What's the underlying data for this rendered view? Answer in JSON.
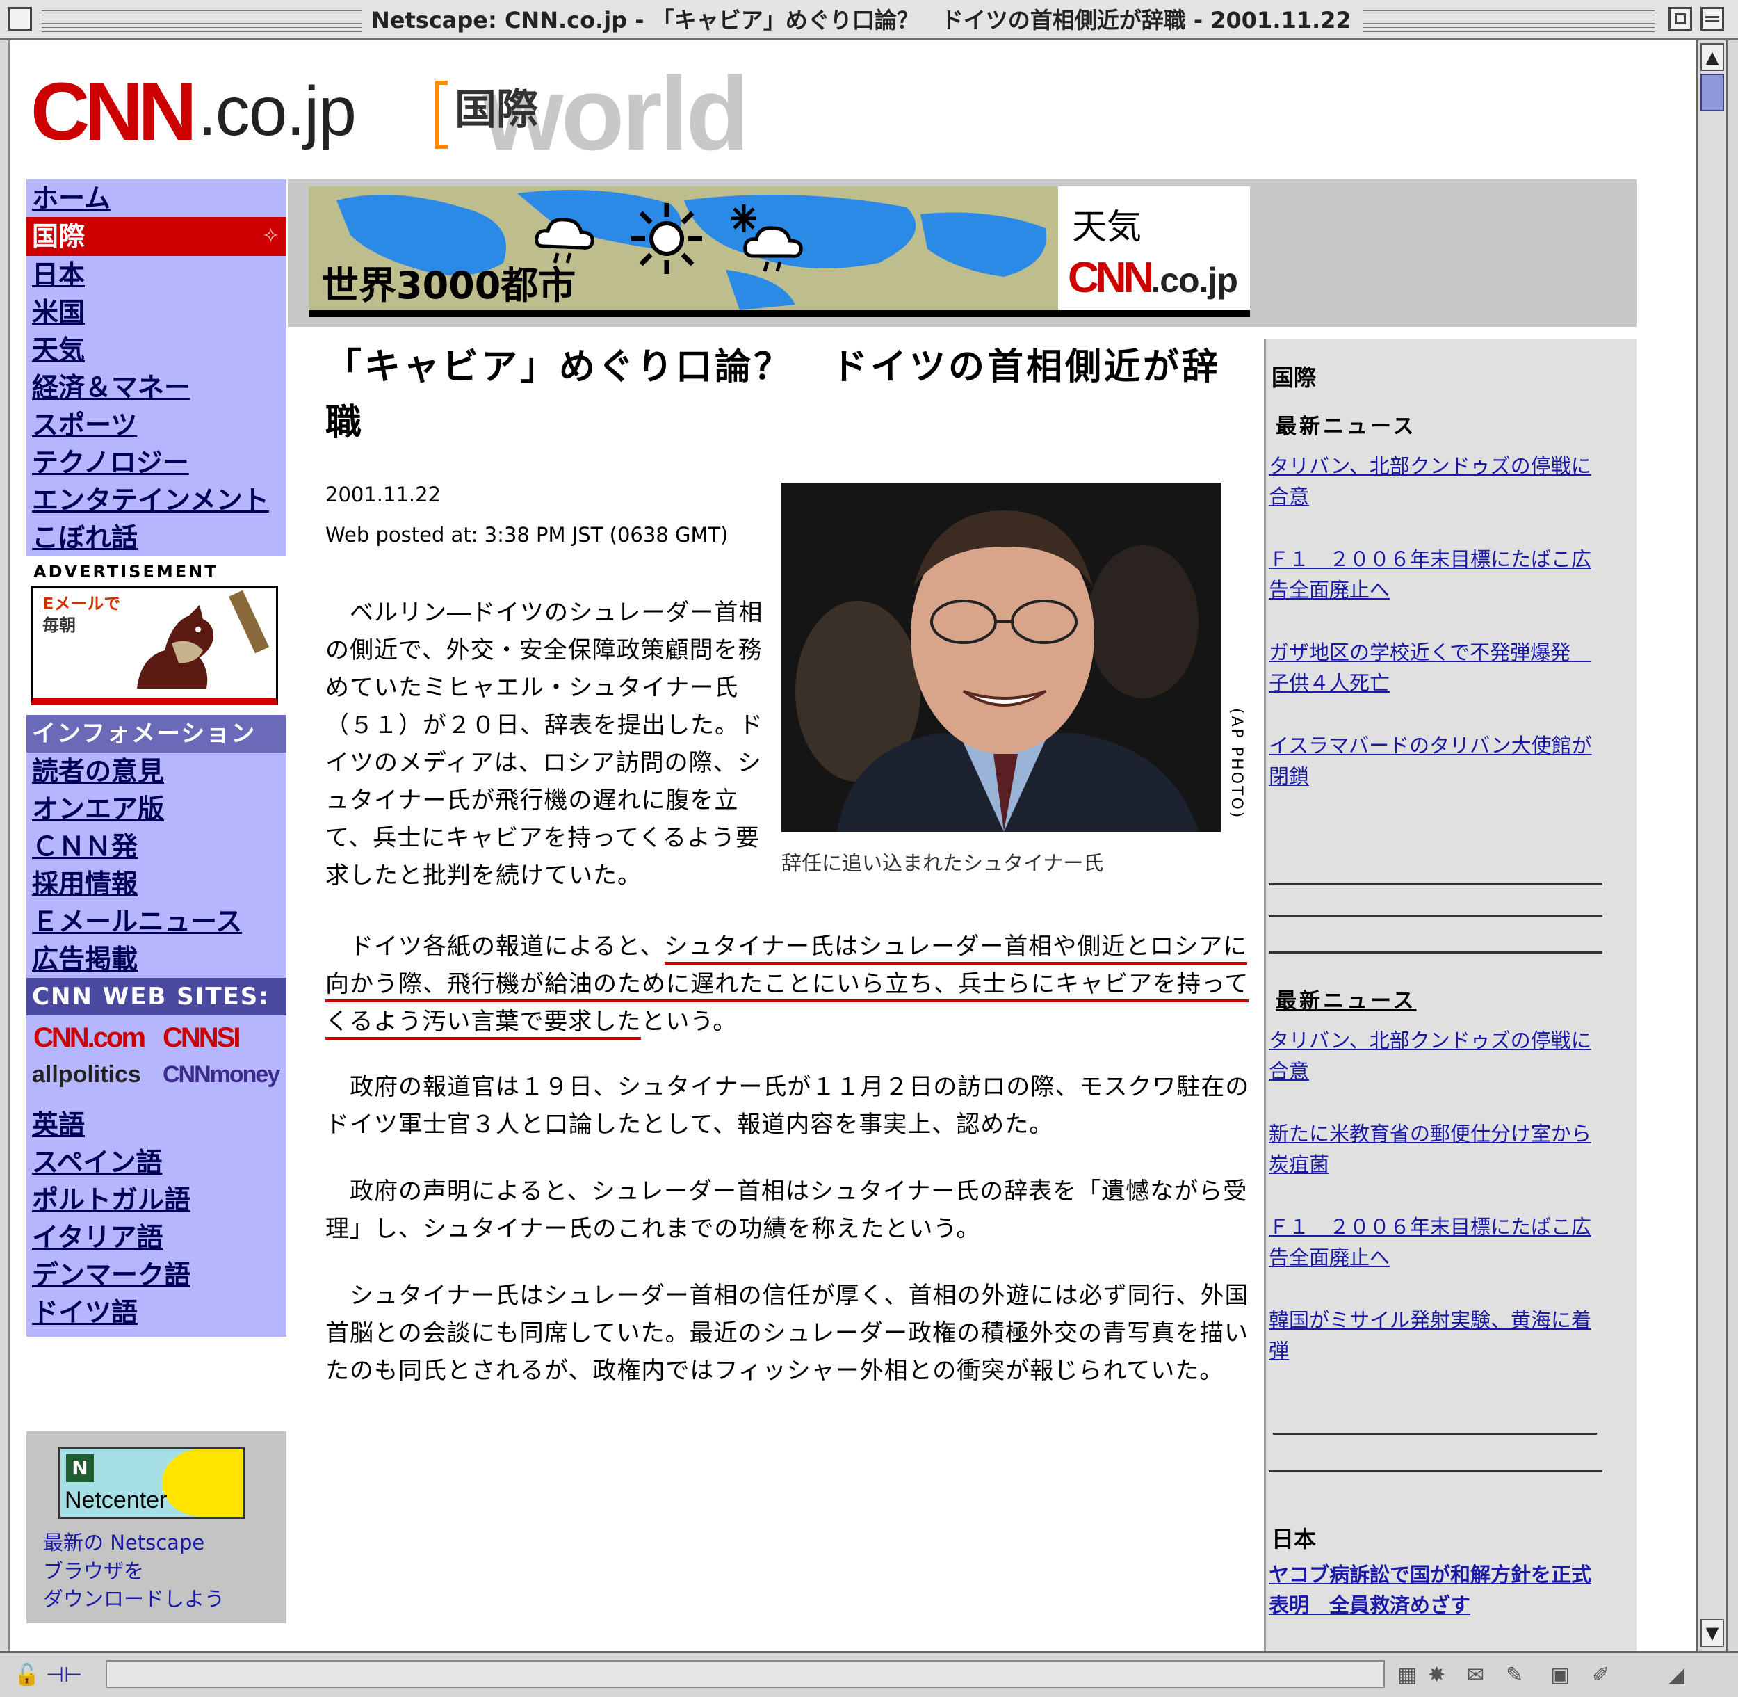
{
  "window": {
    "title": "Netscape: CNN.co.jp - 「キャビア」めぐり口論？　ドイツの首相側近が辞職 - 2001.11.22"
  },
  "site": {
    "logo_main": "CNN",
    "logo_suffix": ".co.jp",
    "section_kanji": "国際",
    "section_en": "world"
  },
  "leftnav": {
    "items_top": [
      "ホーム"
    ],
    "active": "国際",
    "items": [
      "日本",
      "米国",
      "天気",
      "経済＆マネー",
      "スポーツ",
      "テクノロジー",
      "エンタテインメント",
      "こぼれ話"
    ],
    "ad_label": "ADVERTISEMENT",
    "ad_line1": "Eメールで",
    "ad_line2": "毎朝",
    "info_heading": "インフォメーション",
    "info_items": [
      "読者の意見",
      "オンエア版",
      "ＣＮＮ発",
      "採用情報",
      "Ｅメールニュース",
      "広告掲載"
    ],
    "sites_heading": "CNN WEB SITES:",
    "site_logos": [
      "CNN.com",
      "CNNSI",
      "allpolitics",
      "CNNmoney"
    ],
    "languages": [
      "英語",
      "スペイン語",
      "ポルトガル語",
      "イタリア語",
      "デンマーク語",
      "ドイツ語"
    ],
    "netcenter_label": "Netcenter",
    "netcenter_caption": [
      "最新の Netscape",
      "ブラウザを",
      "ダウンロードしよう"
    ]
  },
  "banner": {
    "left_text": "世界3000都市",
    "right_text": "天気",
    "right_logo": "CNN",
    "right_logo_suffix": ".co.jp"
  },
  "article": {
    "headline": "「キャビア」めぐり口論？　ドイツの首相側近が辞職",
    "date": "2001.11.22",
    "posted": "Web posted at: 3:38 PM JST (0638 GMT)",
    "photo_credit": "(AP PHOTO)",
    "photo_caption": "辞任に追い込まれたシュタイナー氏",
    "p1": "　ベルリン―ドイツのシュレーダー首相の側近で、外交・安全保障政策顧問を務めていたミヒャエル・シュタイナー氏（５１）が２０日、辞表を提出した。ドイツのメディアは、ロシア訪問の際、シュタイナー氏が飛行機の遅れに腹を立て、兵士にキャビアを持ってくるよう要求したと批判を続けていた。",
    "p2_pre": "　ドイツ各紙の報道によると、",
    "p2_underlined": "シュタイナー氏はシュレーダー首相や側近とロシアに向かう際、飛行機が給油のために遅れたことにいら立ち、兵士らにキャビアを持ってくるよう汚い言葉で要求した",
    "p2_post": "という。",
    "p3": "　政府の報道官は１９日、シュタイナー氏が１１月２日の訪ロの際、モスクワ駐在のドイツ軍士官３人と口論したとして、報道内容を事実上、認めた。",
    "p4": "　政府の声明によると、シュレーダー首相はシュタイナー氏の辞表を「遺憾ながら受理」し、シュタイナー氏のこれまでの功績を称えたという。",
    "p5": "　シュタイナー氏はシュレーダー首相の信任が厚く、首相の外遊には必ず同行、外国首脳との会談にも同席していた。最近のシュレーダー政権の積極外交の青写真を描いたのも同氏とされるが、政権内ではフィッシャー外相との衝突が報じられていた。"
  },
  "rightcol": {
    "heading": "国際",
    "sub1": "最新ニュース",
    "links1": [
      "タリバン、北部クンドゥズの停戦に合意",
      "Ｆ１　２００６年末目標にたばこ広告全面廃止へ",
      "ガザ地区の学校近くで不発弾爆発　子供４人死亡",
      "イスラマバードのタリバン大使館が閉鎖"
    ],
    "sub2": "最新ニュース",
    "links2": [
      "タリバン、北部クンドゥズの停戦に合意",
      "新たに米教育省の郵便仕分け室から炭疽菌",
      "Ｆ１　２００６年末目標にたばこ広告全面廃止へ",
      "韓国がミサイル発射実験、黄海に着弾"
    ],
    "heading3": "日本",
    "links3": [
      "ヤコブ病訴訟で国が和解方針を正式表明　全員救済めざす"
    ]
  },
  "colors": {
    "cnn_red": "#cc0000",
    "nav_bg": "#b6b6ff",
    "link": "#1a1aa6"
  },
  "icons": [
    "close-box-icon",
    "zoom-box-icon",
    "collapse-box-icon",
    "scroll-up-icon",
    "scroll-down-icon",
    "lock-icon",
    "connection-icon"
  ]
}
